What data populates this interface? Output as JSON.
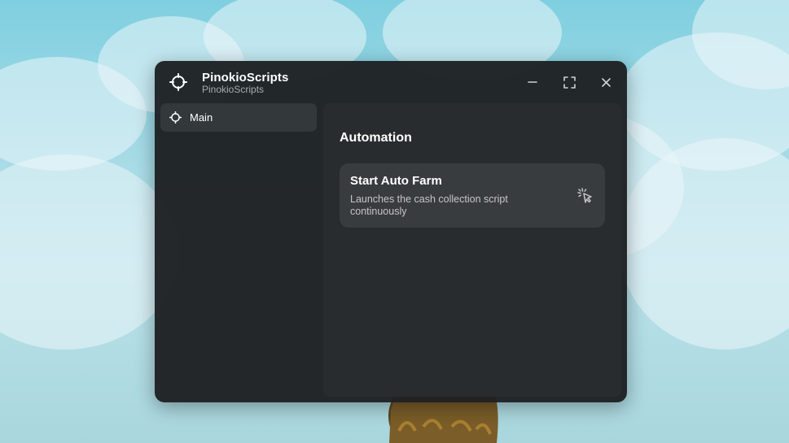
{
  "window": {
    "title": "PinokioScripts",
    "subtitle": "PinokioScripts",
    "icons": {
      "app": "crosshair-icon",
      "minimize": "minimize-icon",
      "maximize": "maximize-icon",
      "close": "close-icon"
    }
  },
  "sidebar": {
    "items": [
      {
        "label": "Main",
        "icon": "crosshair-icon",
        "active": true
      }
    ]
  },
  "main": {
    "section_title": "Automation",
    "buttons": [
      {
        "title": "Start Auto Farm",
        "description": "Launches the cash collection script continuously",
        "icon": "pointer-click-icon"
      }
    ]
  },
  "colors": {
    "window_bg": "#1e2123",
    "panel_bg": "#292c2e",
    "card_bg": "#393c3f",
    "nav_active_bg": "#33383a",
    "sky": "#a6dbe6"
  }
}
